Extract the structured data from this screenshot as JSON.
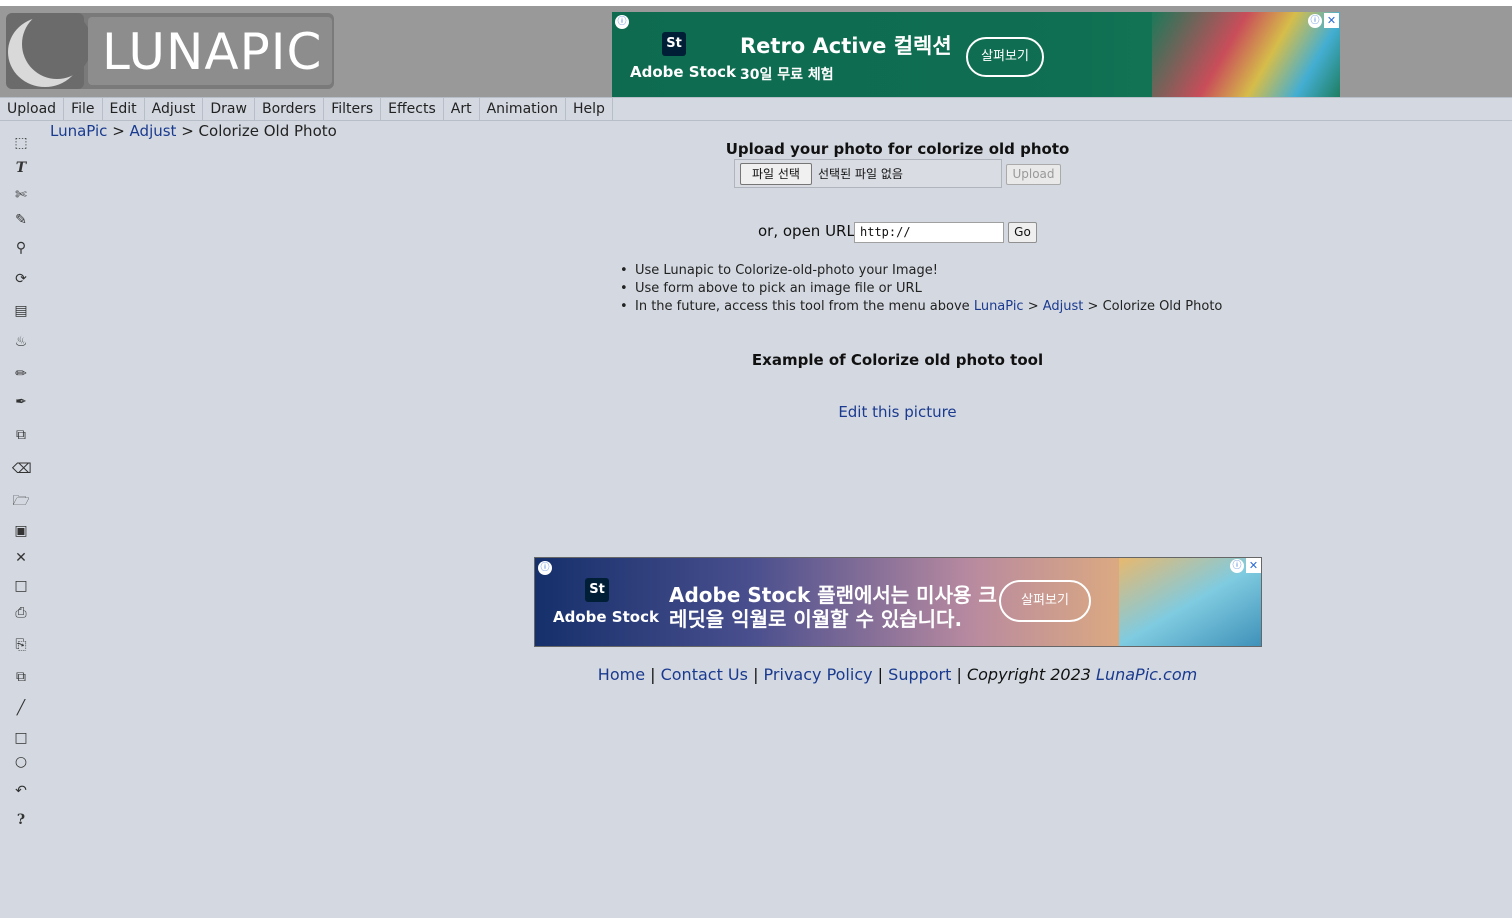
{
  "header": {
    "logo_text": "LUNAPIC",
    "ad_top": {
      "badge": "St",
      "brand": "Adobe Stock",
      "headline": "Retro Active 컬렉션",
      "sub": "30일 무료 체험",
      "cta": "살펴보기"
    }
  },
  "menu": {
    "items": [
      "Upload",
      "File",
      "Edit",
      "Adjust",
      "Draw",
      "Borders",
      "Filters",
      "Effects",
      "Art",
      "Animation",
      "Help"
    ]
  },
  "toolbar": {
    "icons": [
      "select-icon",
      "text-icon",
      "scissors-icon",
      "pencil-icon",
      "zoom-icon",
      "rotate-icon",
      "gradient-icon",
      "fill-bucket-icon",
      "eyedropper-icon",
      "brush-icon",
      "layers-icon",
      "eraser-icon",
      "open-folder-icon",
      "save-icon",
      "close-icon",
      "new-file-icon",
      "print-icon",
      "paste-icon",
      "copy-icon",
      "line-icon",
      "rectangle-icon",
      "circle-icon",
      "undo-icon",
      "help-icon"
    ]
  },
  "breadcrumb": {
    "home": "LunaPic",
    "sep1": " > ",
    "section": "Adjust",
    "sep2": " > ",
    "current": "Colorize Old Photo"
  },
  "upload": {
    "title": "Upload your photo for colorize old photo",
    "file_button": "파일 선택",
    "file_status": "선택된 파일 없음",
    "upload_button": "Upload"
  },
  "url": {
    "label": "or, open URL",
    "value": "http://",
    "go_button": "Go"
  },
  "tips": {
    "t1": "Use Lunapic to Colorize-old-photo your Image!",
    "t2": "Use form above to pick an image file or URL",
    "t3_prefix": "In the future, access this tool from the menu above ",
    "t3_link1": "LunaPic",
    "t3_sep1": " > ",
    "t3_link2": "Adjust",
    "t3_suffix": " > Colorize Old Photo"
  },
  "example": {
    "title": "Example of Colorize old photo tool",
    "edit_link": "Edit this picture"
  },
  "ad_bottom": {
    "badge": "St",
    "brand": "Adobe Stock",
    "headline1": "Adobe Stock 플랜에서는 미사용 크",
    "headline2": "레딧을 익월로 이월할 수 있습니다.",
    "cta": "살펴보기"
  },
  "footer": {
    "home": "Home",
    "contact": "Contact Us",
    "privacy": "Privacy Policy",
    "support": "Support",
    "sep": " | ",
    "copyright_prefix": "Copyright 2023 ",
    "copyright_link": "LunaPic.com"
  }
}
